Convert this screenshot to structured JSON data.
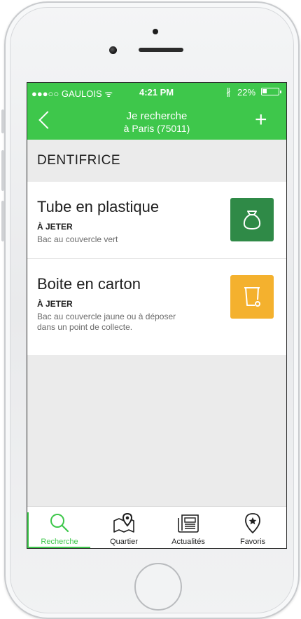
{
  "status_bar": {
    "carrier": "●●●○○ GAULOIS ᯤ",
    "time": "4:21 PM",
    "bluetooth": "∦",
    "battery": "22%"
  },
  "header": {
    "title_line1": "Je recherche",
    "title_line2": "à Paris (75011)",
    "add_label": "+"
  },
  "section_title": "DENTIFRICE",
  "items": [
    {
      "name": "Tube en plastique",
      "action": "À JETER",
      "description": "Bac au couvercle vert",
      "bin_color": "#2f8a47",
      "bin_icon": "bag-icon"
    },
    {
      "name": "Boite en carton",
      "action": "À JETER",
      "description": "Bac au couvercle jaune ou à déposer dans un point de collecte.",
      "bin_color": "#f4b12e",
      "bin_icon": "bin-icon"
    }
  ],
  "tabs": [
    {
      "label": "Recherche",
      "icon": "search-icon",
      "active": true
    },
    {
      "label": "Quartier",
      "icon": "map-pin-icon",
      "active": false
    },
    {
      "label": "Actualités",
      "icon": "newspaper-icon",
      "active": false
    },
    {
      "label": "Favoris",
      "icon": "star-pin-icon",
      "active": false
    }
  ],
  "colors": {
    "accent": "#3ec74b",
    "bin_green": "#2f8a47",
    "bin_yellow": "#f4b12e"
  }
}
